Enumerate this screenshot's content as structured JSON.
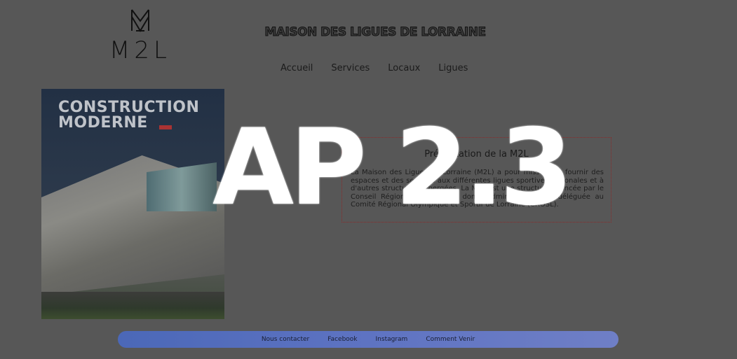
{
  "header": {
    "logo_text": "M2L",
    "site_title": "MAISON DES LIGUES DE LORRAINE"
  },
  "nav": {
    "items": [
      "Accueil",
      "Services",
      "Locaux",
      "Ligues"
    ]
  },
  "cover": {
    "title_line1": "CONSTRUCTION",
    "title_line2": "MODERNE"
  },
  "presentation": {
    "title": "Présentation de la M2L",
    "text": "La Maison des Ligues de Lorraine (M2L) a pour mission de fournir des espaces et des services aux différentes ligues sportives régionales et à d'autres structures hébergées. La M2L est une structure financée par le Conseil Régional de Lorraine dont l'administration est déléguée au Comité Régional Olympique et Sportif de Lorraine (CROSL)."
  },
  "overlay": {
    "title": "AP 2.3"
  },
  "footer": {
    "links": [
      "Nous contacter",
      "Facebook",
      "Instagram",
      "Comment Venir"
    ]
  },
  "colors": {
    "background": "#575757",
    "footer_bar": "#5e73c2",
    "presentation_border": "#8a2a2a",
    "overlay_text": "#ffffff"
  },
  "icons": {
    "logo_mark": "m2l-monogram-icon"
  }
}
